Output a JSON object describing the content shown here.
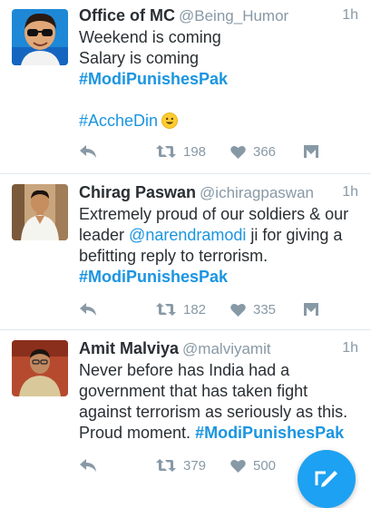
{
  "tweets": [
    {
      "name": "Office of MC",
      "handle": "@Being_Humor",
      "time": "1h",
      "lines": [
        "Weekend is coming",
        "Salary is coming"
      ],
      "hashtag1": "#ModiPunishesPak",
      "hashtag2": "#AccheDin",
      "emoji": "smiley-emoji",
      "retweets": "198",
      "likes": "366"
    },
    {
      "name": "Chirag Paswan",
      "handle": "@ichiragpaswan",
      "time": "1h",
      "line1": "Extremely proud of our soldiers & our",
      "line2_pre": "leader ",
      "mention": "@narendramodi",
      "line2_post": " ji for giving a",
      "line3": "befitting reply to terrorism.",
      "hashtag": "#ModiPunishesPak",
      "retweets": "182",
      "likes": "335"
    },
    {
      "name": "Amit Malviya",
      "handle": "@malviyamit",
      "time": "1h",
      "lines": [
        "Never before has India had a",
        "government that has taken fight",
        "against terrorism as seriously as this."
      ],
      "line4_pre": "Proud moment. ",
      "hashtag": "#ModiPunishesPak",
      "retweets": "379",
      "likes": "500"
    }
  ],
  "icons": {
    "reply": "reply-icon",
    "retweet": "retweet-icon",
    "like": "heart-icon",
    "dm": "dm-icon",
    "compose": "compose-tweet-icon"
  },
  "colors": {
    "link": "#1b95e0",
    "muted": "#8899a6",
    "text": "#292f33",
    "fab": "#1da1f2"
  }
}
